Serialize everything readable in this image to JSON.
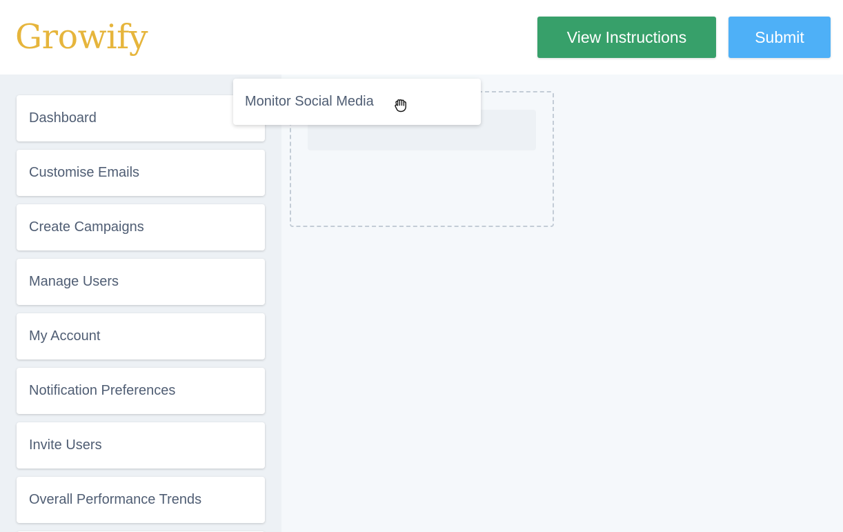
{
  "header": {
    "logo": "Growify",
    "view_instructions_label": "View Instructions",
    "submit_label": "Submit"
  },
  "colors": {
    "brand": "#e6b53c",
    "instructions_button": "#37a06a",
    "submit_button": "#4eb0f7"
  },
  "sidebar": {
    "items": [
      {
        "label": "Dashboard"
      },
      {
        "label": "Customise Emails"
      },
      {
        "label": "Create Campaigns"
      },
      {
        "label": "Manage Users"
      },
      {
        "label": "My Account"
      },
      {
        "label": "Notification Preferences"
      },
      {
        "label": "Invite Users"
      },
      {
        "label": "Overall Performance Trends"
      }
    ]
  },
  "drag": {
    "item_label": "Monitor Social Media",
    "cursor_icon": "grab-hand-icon"
  }
}
